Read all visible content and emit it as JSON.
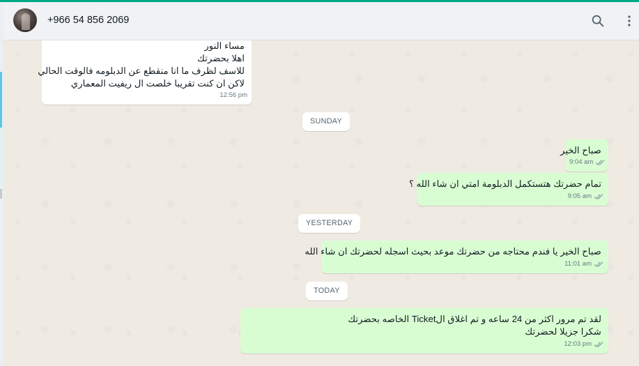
{
  "window": {
    "accent_color": "#00a884"
  },
  "header": {
    "contact_name": "+966 54 856 2069",
    "search_icon": "search-icon",
    "menu_icon": "kebab-menu-icon"
  },
  "dates": {
    "sunday": "SUNDAY",
    "yesterday": "YESTERDAY",
    "today": "TODAY"
  },
  "messages": [
    {
      "direction": "incoming",
      "lines": [
        "مساء النور",
        "اهلا بحضرتك",
        "للاسف لظرف ما انا منقطع عن الدبلومه فالوقت الحالي",
        "لاكن ان كنت تقريبا خلصت ال ريفيت المعماري"
      ],
      "time": "12:56 pm"
    },
    {
      "direction": "outgoing",
      "lines": [
        "صباح الخير"
      ],
      "time": "9:04 am",
      "status": "read"
    },
    {
      "direction": "outgoing",
      "lines": [
        "تمام حضرتك هتستكمل الدبلومة امتي ان شاء الله ؟"
      ],
      "time": "9:05 am",
      "status": "read"
    },
    {
      "direction": "outgoing",
      "lines": [
        "صباح الخير يا فندم محتاجه من حضرتك موعد بحيث اسجله لحضرتك ان شاء الله"
      ],
      "time": "11:01 am",
      "status": "read"
    },
    {
      "direction": "outgoing",
      "lines": [
        "لقد تم مرور اكثر من 24 ساعه و تم اغلاق الTicket الخاصه بحضرتك",
        "شكرا جزيلا لحضرتك"
      ],
      "time": "12:03 pm",
      "status": "read"
    }
  ],
  "colors": {
    "incoming_bubble": "#ffffff",
    "outgoing_bubble": "#d9fdd3",
    "chat_background": "#efeae2",
    "read_ticks": "#8696a0"
  }
}
